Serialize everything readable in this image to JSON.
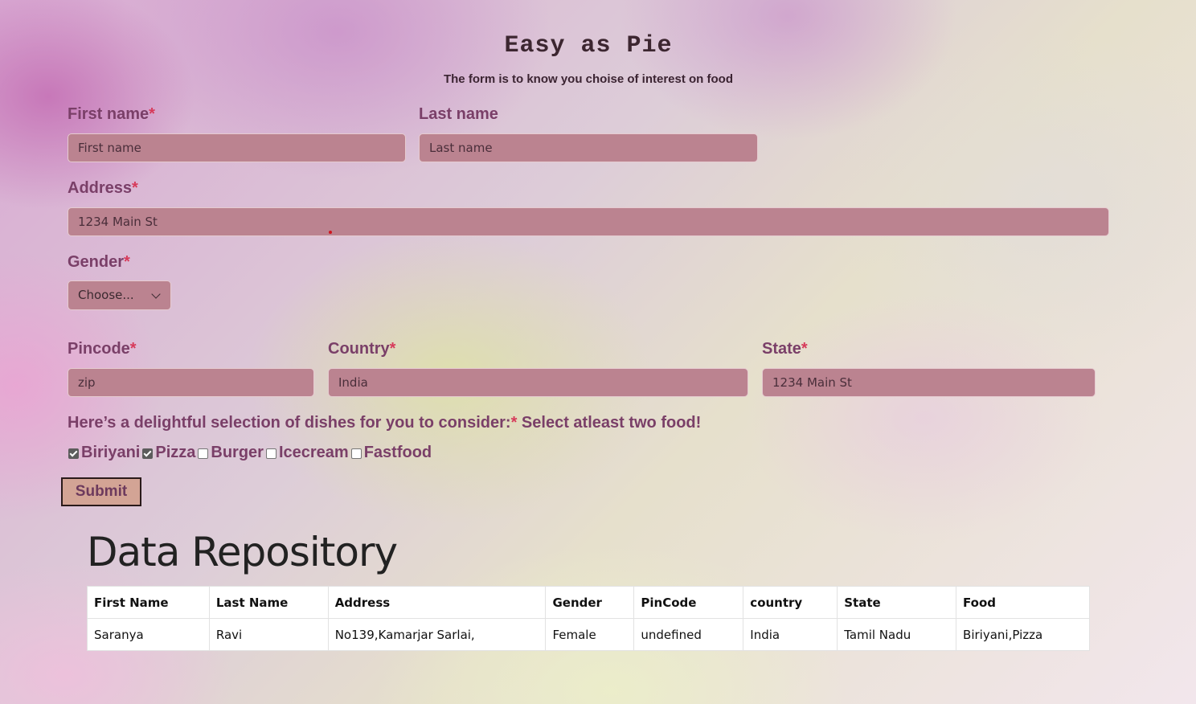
{
  "header": {
    "title": "Easy as Pie",
    "subtitle": "The form is to know you choise of interest on food"
  },
  "form": {
    "first_name": {
      "label": "First name",
      "required_mark": "*",
      "placeholder": "First name"
    },
    "last_name": {
      "label": "Last name",
      "placeholder": "Last name"
    },
    "address": {
      "label": "Address",
      "required_mark": "*",
      "placeholder": "1234 Main St"
    },
    "gender": {
      "label": "Gender",
      "required_mark": "*",
      "selected": "Choose..."
    },
    "pincode": {
      "label": "Pincode",
      "required_mark": "*",
      "placeholder": "zip"
    },
    "country": {
      "label": "Country",
      "required_mark": "*",
      "placeholder": "India"
    },
    "state": {
      "label": "State",
      "required_mark": "*",
      "placeholder": "1234 Main St"
    },
    "food": {
      "label": "Here’s a delightful selection of dishes for you to consider:",
      "required_mark": "*",
      "hint": " Select atleast two food!",
      "options": [
        {
          "label": "Biriyani",
          "checked": true
        },
        {
          "label": "Pizza",
          "checked": true
        },
        {
          "label": "Burger",
          "checked": false
        },
        {
          "label": "Icecream",
          "checked": false
        },
        {
          "label": "Fastfood",
          "checked": false
        }
      ]
    },
    "submit_label": "Submit"
  },
  "repository": {
    "title": "Data Repository",
    "columns": [
      "First Name",
      "Last Name",
      "Address",
      "Gender",
      "PinCode",
      "country",
      "State",
      "Food"
    ],
    "rows": [
      [
        "Saranya",
        "Ravi",
        "No139,Kamarjar Sarlai,",
        "Female",
        "undefined",
        "India",
        "Tamil Nadu",
        "Biriyani,Pizza"
      ]
    ]
  }
}
